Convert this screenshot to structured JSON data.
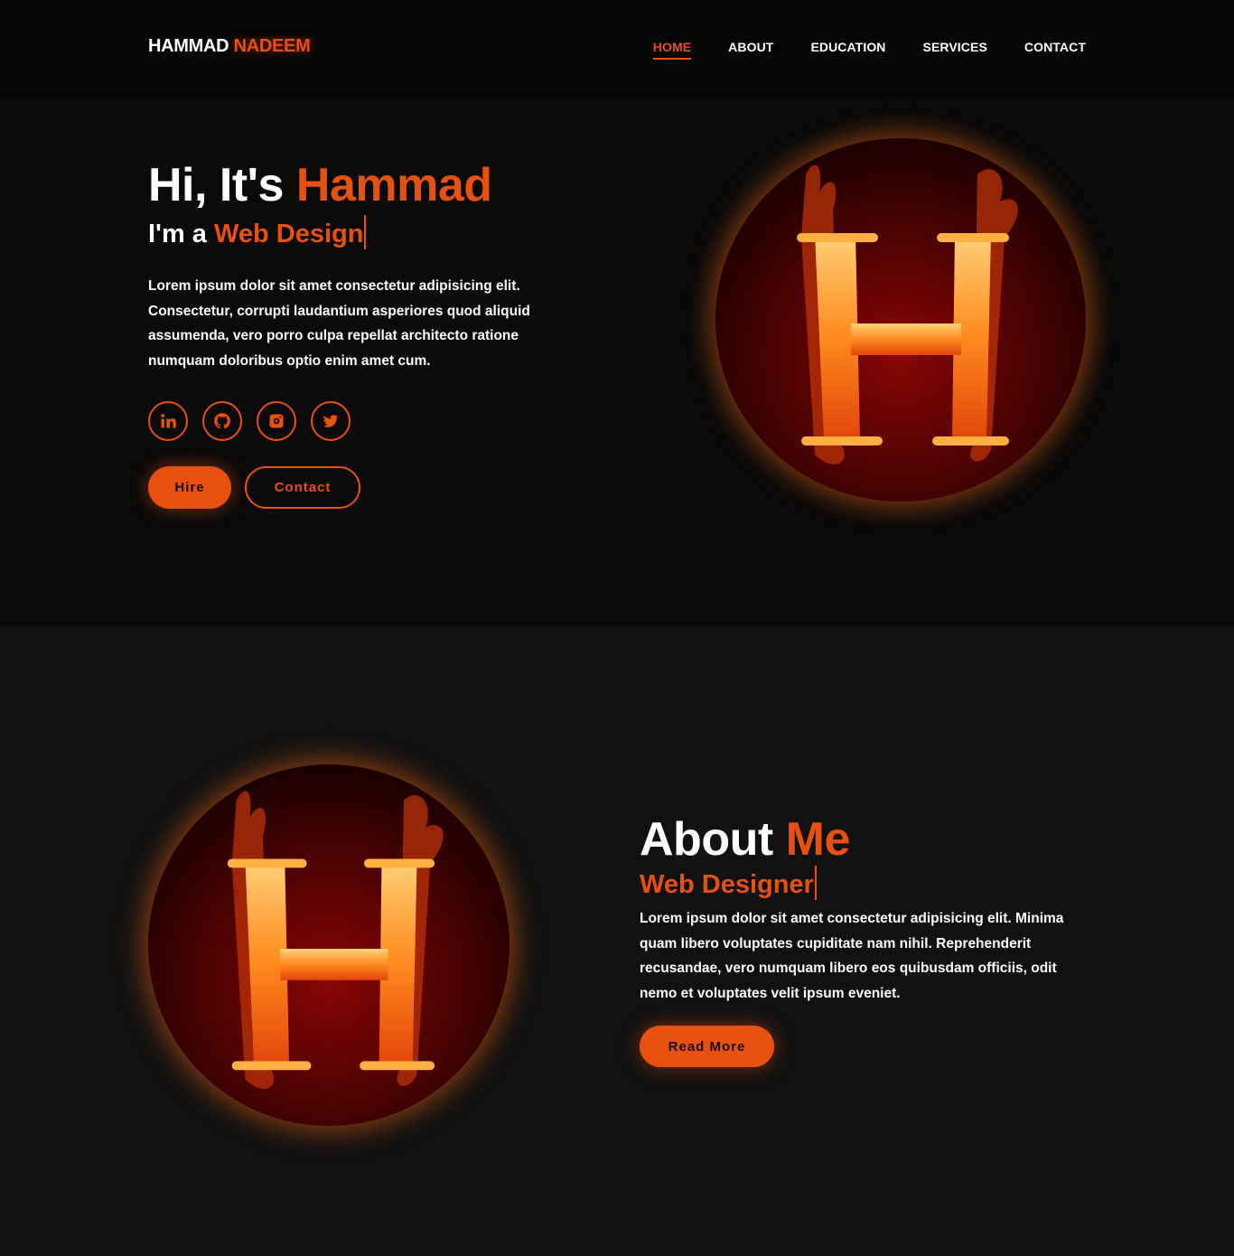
{
  "header": {
    "logo_first": "HAMMAD",
    "logo_second": "NADEEM",
    "nav": [
      {
        "label": "HOME",
        "active": true
      },
      {
        "label": "ABOUT"
      },
      {
        "label": "EDUCATION"
      },
      {
        "label": "SERVICES"
      },
      {
        "label": "CONTACT"
      }
    ]
  },
  "hero": {
    "greeting": "Hi, It's",
    "name": "Hammad",
    "sub_prefix": "I'm a",
    "role_typed": "Web Design",
    "description": "Lorem ipsum dolor sit amet consectetur adipisicing elit. Consectetur, corrupti laudantium asperiores quod aliquid assumenda, vero porro culpa repellat architecto ratione numquam doloribus optio enim amet cum.",
    "socials": [
      "linkedin-icon",
      "github-icon",
      "instagram-icon",
      "twitter-icon"
    ],
    "hire_label": "Hire",
    "contact_label": "Contact"
  },
  "about": {
    "title_first": "About",
    "title_second": "Me",
    "role": "Web Designer",
    "description": "Lorem ipsum dolor sit amet consectetur adipisicing elit. Minima quam libero voluptates cupiditate nam nihil. Reprehenderit recusandae, vero numquam libero eos quibusdam officiis, odit nemo et voluptates velit ipsum eveniet.",
    "read_more_label": "Read More"
  },
  "colors": {
    "accent": "#e8500f",
    "background": "#0a0a0a",
    "about_background": "#111111"
  }
}
